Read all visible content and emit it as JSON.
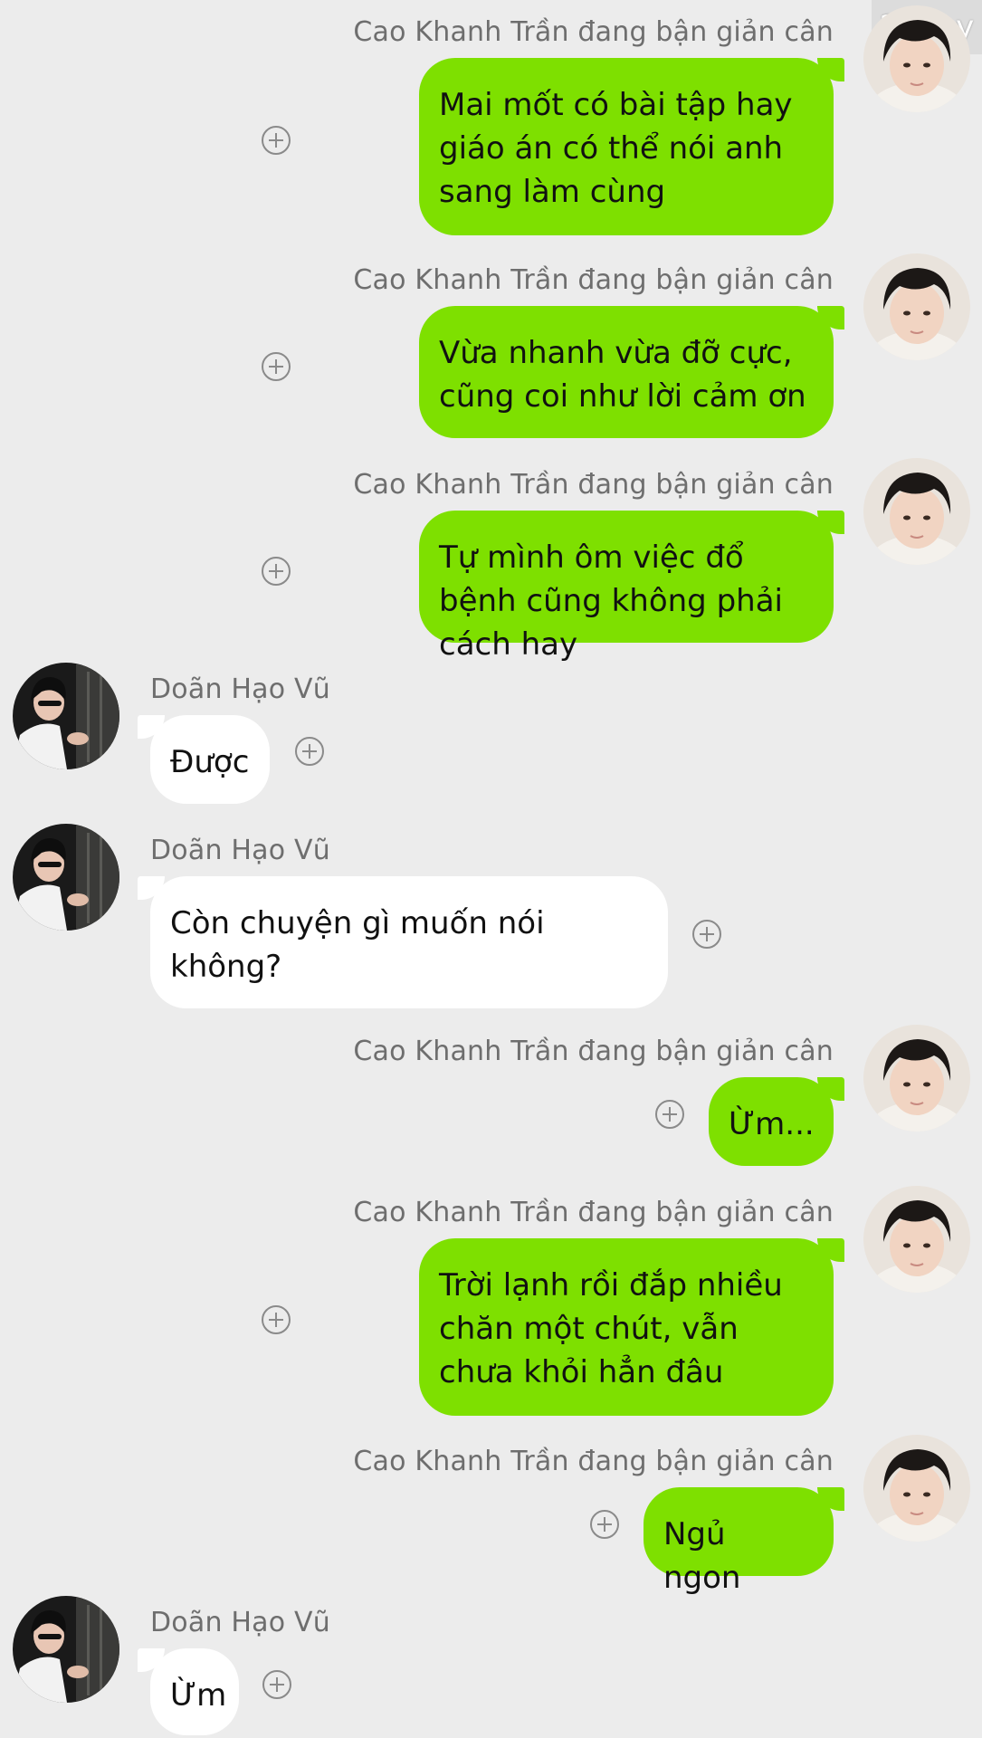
{
  "watermark": "28 joy",
  "messages": [
    {
      "sender": "Cao Khanh Trần đang bận giản cân",
      "text": "Mai mốt có bài tập hay giáo án có thể nói anh sang làm cùng",
      "side": "me"
    },
    {
      "sender": "Cao Khanh Trần đang bận giản cân",
      "text": "Vừa nhanh vừa đỡ cực, cũng coi như lời cảm ơn",
      "side": "me"
    },
    {
      "sender": "Cao Khanh Trần đang bận giản cân",
      "text": "Tự mình ôm việc đổ bệnh cũng không phải cách hay",
      "side": "me"
    },
    {
      "sender": "Doãn Hạo Vũ",
      "text": "Được",
      "side": "them"
    },
    {
      "sender": "Doãn Hạo Vũ",
      "text": "Còn chuyện gì muốn nói không?",
      "side": "them"
    },
    {
      "sender": "Cao Khanh Trần đang bận giản cân",
      "text": "Ừm...",
      "side": "me"
    },
    {
      "sender": "Cao Khanh Trần đang bận giản cân",
      "text": "Trời lạnh rồi đắp nhiều chăn một chút, vẫn chưa khỏi hẳn đâu",
      "side": "me"
    },
    {
      "sender": "Cao Khanh Trần đang bận giản cân",
      "text": "Ngủ ngon",
      "side": "me"
    },
    {
      "sender": "Doãn Hạo Vũ",
      "text": "Ừm",
      "side": "them"
    }
  ],
  "colors": {
    "my_bubble": "#7ee000",
    "their_bubble": "#ffffff",
    "background": "#ececec"
  },
  "icons": {
    "add_reaction": "plus-circle-icon"
  }
}
